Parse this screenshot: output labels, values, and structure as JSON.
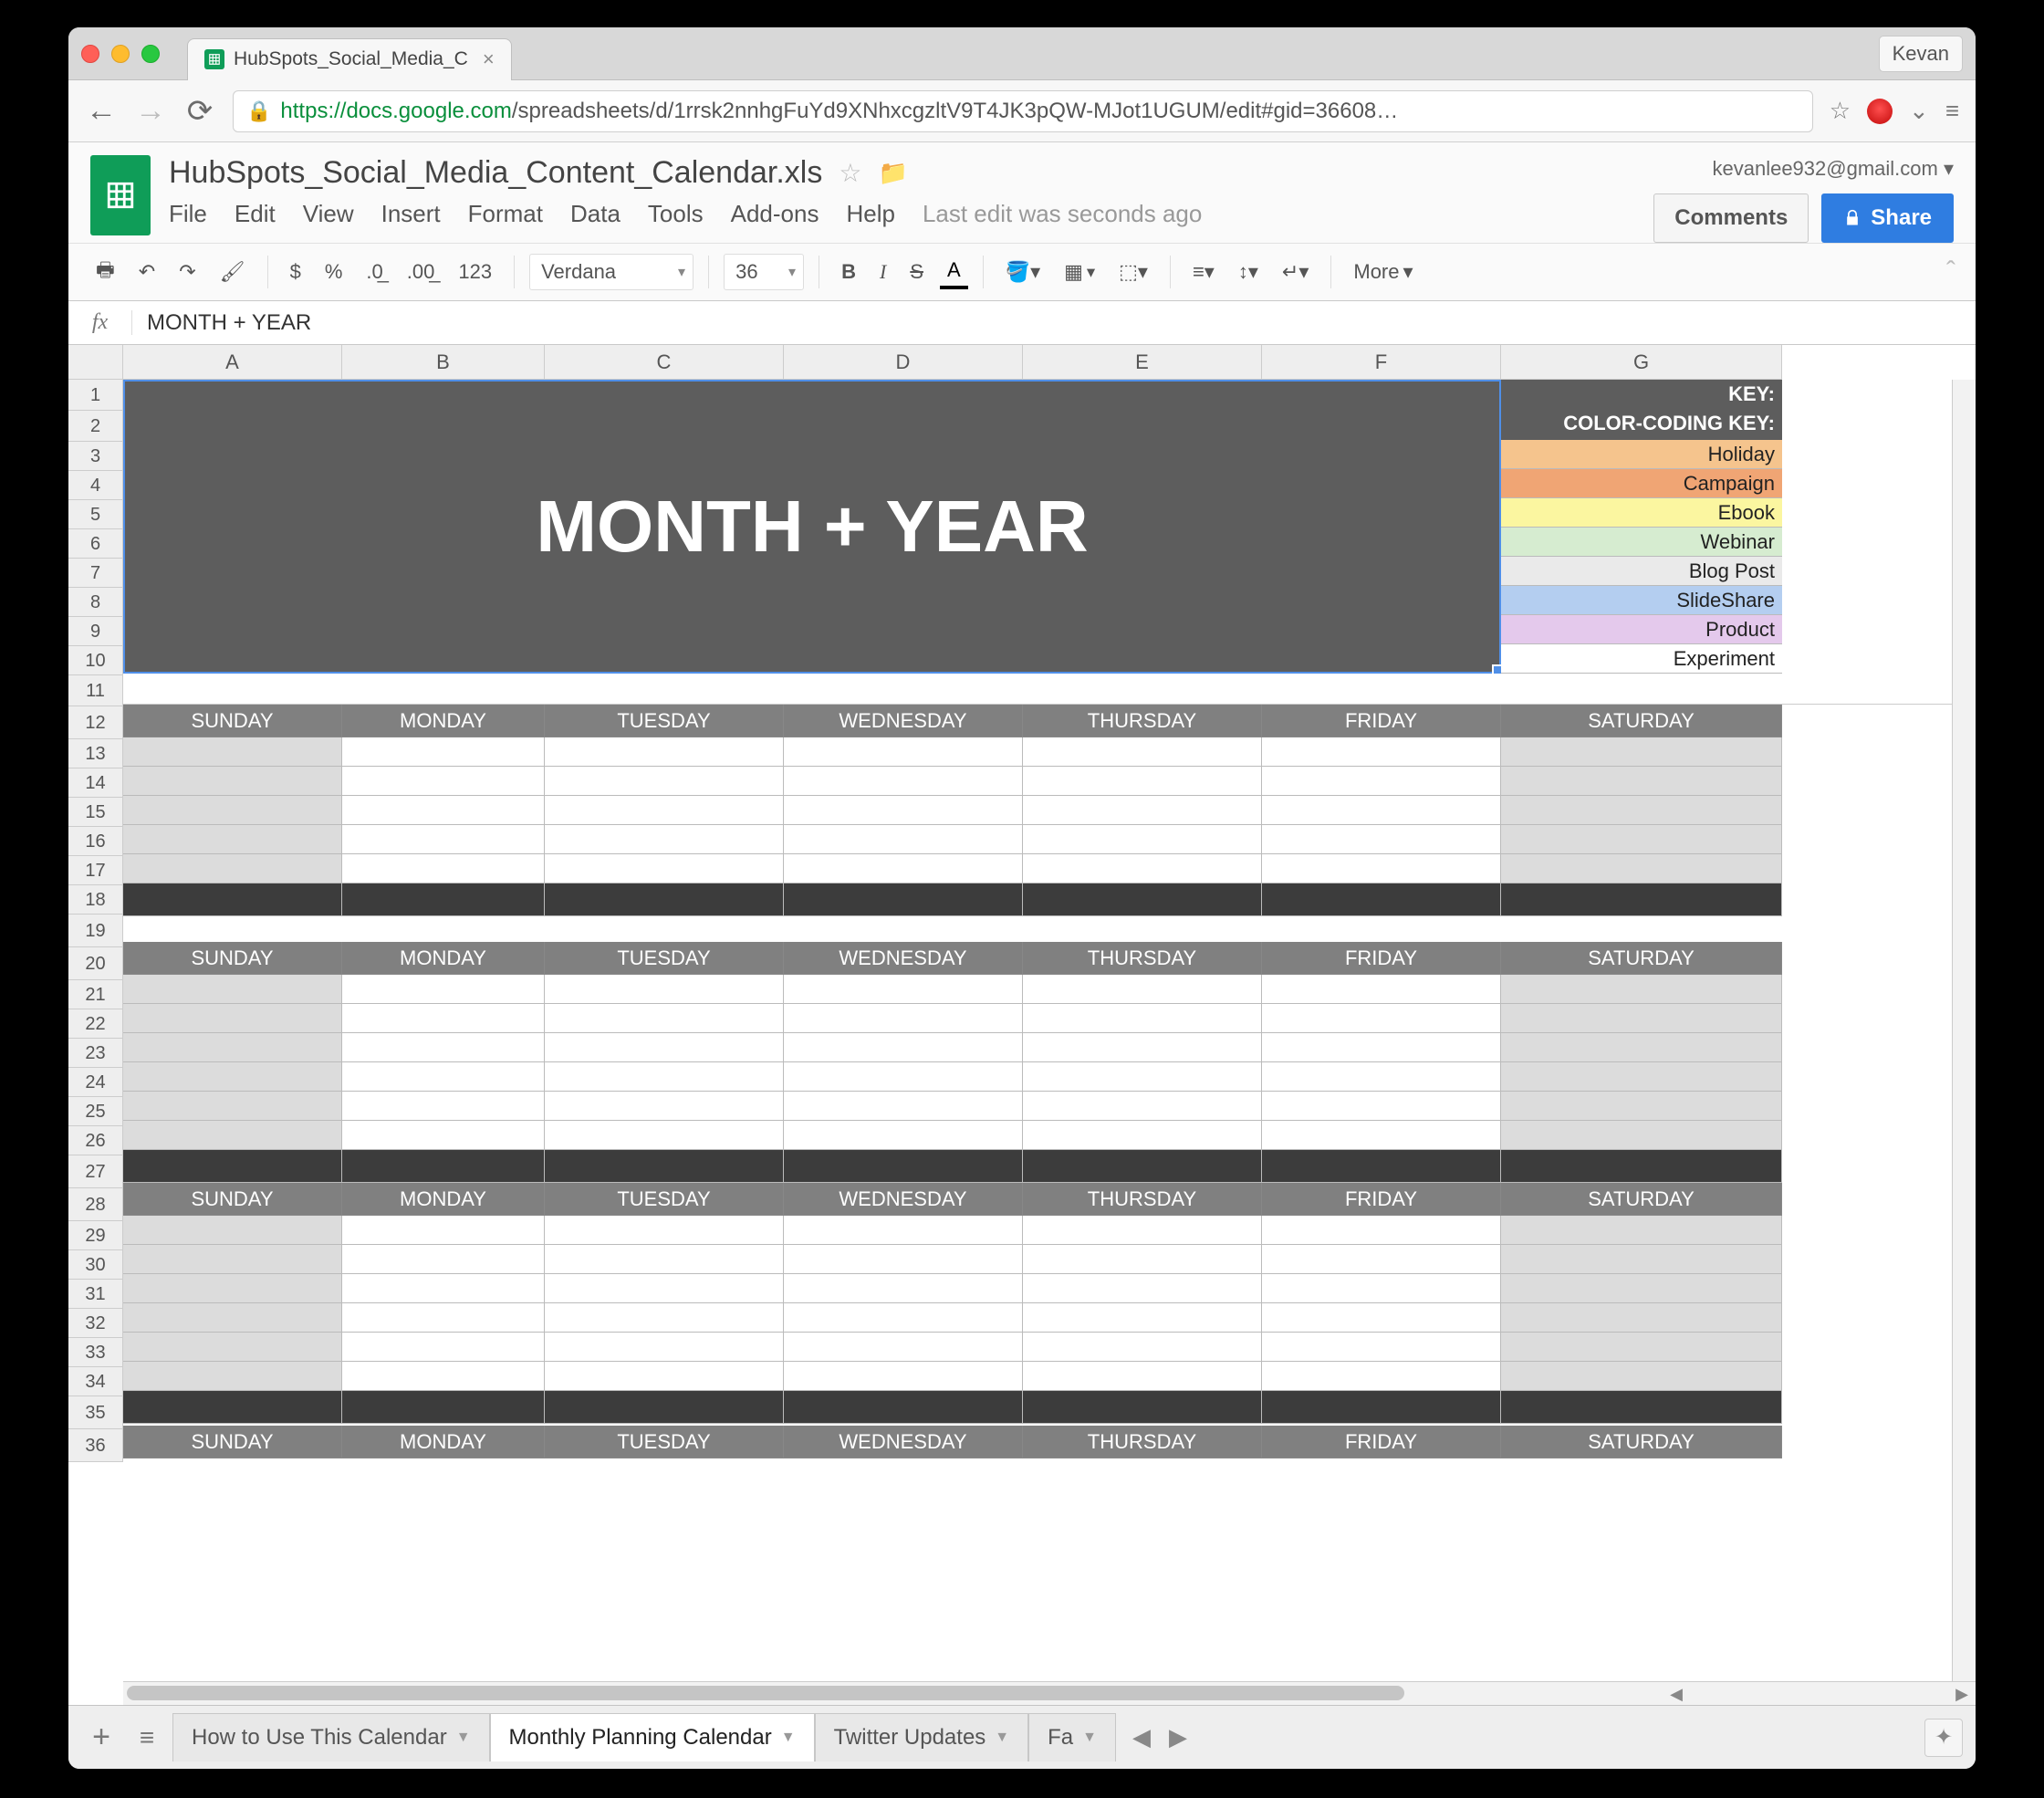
{
  "browser": {
    "tab_title": "HubSpots_Social_Media_C",
    "profile": "Kevan",
    "url_scheme": "https",
    "url_host": "://docs.google.com",
    "url_path": "/spreadsheets/d/1rrsk2nnhgFuYd9XNhxcgzltV9T4JK3pQW-MJot1UGUM/edit#gid=36608…"
  },
  "doc": {
    "name": "HubSpots_Social_Media_Content_Calendar.xls",
    "email": "kevanlee932@gmail.com ▾",
    "comments": "Comments",
    "share": "Share",
    "last_edit": "Last edit was seconds ago",
    "menus": [
      "File",
      "Edit",
      "View",
      "Insert",
      "Format",
      "Data",
      "Tools",
      "Add-ons",
      "Help"
    ]
  },
  "toolbar": {
    "currency": "$",
    "percent": "%",
    "dec_dec": ".0←",
    "dec_inc": ".00→",
    "num123": "123",
    "font": "Verdana",
    "size": "36",
    "bold": "B",
    "italic": "I",
    "strike": "S",
    "textcolor": "A",
    "more": "More"
  },
  "formula_bar": {
    "label": "fx",
    "value": "MONTH + YEAR"
  },
  "columns": [
    "A",
    "B",
    "C",
    "D",
    "E",
    "F",
    "G"
  ],
  "row_numbers": [
    1,
    2,
    3,
    4,
    5,
    6,
    7,
    8,
    9,
    10,
    11,
    12,
    13,
    14,
    15,
    16,
    17,
    18,
    19,
    20,
    21,
    22,
    23,
    24,
    25,
    26,
    27,
    28,
    29,
    30,
    31,
    32,
    33,
    34,
    35,
    36
  ],
  "big_title": "MONTH + YEAR",
  "key": {
    "header": "KEY:",
    "subheader": "COLOR-CODING KEY:",
    "items": [
      {
        "label": "Holiday",
        "color": "#f5c48d"
      },
      {
        "label": "Campaign",
        "color": "#f0a574"
      },
      {
        "label": "Ebook",
        "color": "#fbf6a0"
      },
      {
        "label": "Webinar",
        "color": "#d6ecd0"
      },
      {
        "label": "Blog Post",
        "color": "#eaeaea"
      },
      {
        "label": "SlideShare",
        "color": "#b4cef0"
      },
      {
        "label": "Product",
        "color": "#e4c9ec"
      },
      {
        "label": "Experiment",
        "color": "#ffffff"
      }
    ]
  },
  "weekdays": [
    "SUNDAY",
    "MONDAY",
    "TUESDAY",
    "WEDNESDAY",
    "THURSDAY",
    "FRIDAY",
    "SATURDAY"
  ],
  "sheet_tabs": [
    {
      "label": "How to Use This Calendar",
      "active": false
    },
    {
      "label": "Monthly Planning Calendar",
      "active": true
    },
    {
      "label": "Twitter Updates",
      "active": false
    },
    {
      "label": "Fa",
      "active": false
    }
  ]
}
